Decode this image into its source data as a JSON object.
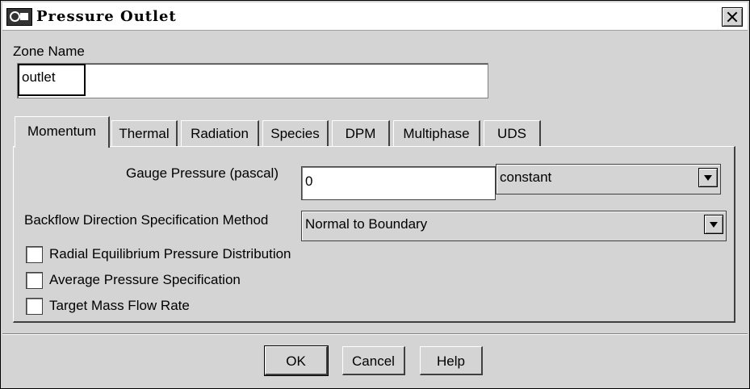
{
  "window": {
    "title": "Pressure Outlet"
  },
  "zone": {
    "label": "Zone Name",
    "value": "outlet"
  },
  "tabs": [
    {
      "label": "Momentum",
      "active": true
    },
    {
      "label": "Thermal"
    },
    {
      "label": "Radiation"
    },
    {
      "label": "Species"
    },
    {
      "label": "DPM"
    },
    {
      "label": "Multiphase"
    },
    {
      "label": "UDS"
    }
  ],
  "momentum": {
    "gauge_pressure": {
      "label": "Gauge Pressure (pascal)",
      "value": "0",
      "profile": "constant"
    },
    "backflow": {
      "label": "Backflow Direction Specification Method",
      "value": "Normal to Boundary"
    },
    "checkboxes": [
      {
        "label": "Radial Equilibrium Pressure Distribution",
        "checked": false
      },
      {
        "label": "Average Pressure Specification",
        "checked": false
      },
      {
        "label": "Target Mass Flow Rate",
        "checked": false
      }
    ]
  },
  "buttons": {
    "ok": "OK",
    "cancel": "Cancel",
    "help": "Help"
  }
}
